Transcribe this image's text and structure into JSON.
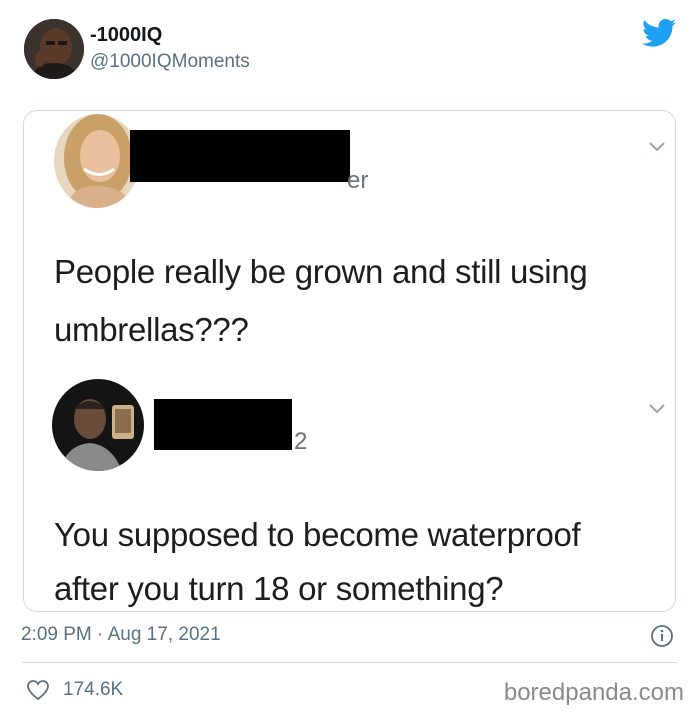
{
  "author": {
    "display_name": "-1000IQ",
    "handle": "@1000IQMoments"
  },
  "embedded": {
    "post1_username_partial": "er",
    "post1_text_line1": "People really be grown and still using",
    "post1_text_line2": "umbrellas???",
    "post2_username_partial": "2",
    "post2_text_line1": "You supposed to become waterproof",
    "post2_text_line2": "after you turn 18 or something?"
  },
  "footer": {
    "timestamp": "2:09 PM · Aug 17, 2021",
    "likes": "174.6K"
  },
  "watermark": "boredpanda.com",
  "colors": {
    "twitter_blue": "#1da1f2",
    "muted": "#5b7083",
    "border": "#cfd9de"
  }
}
